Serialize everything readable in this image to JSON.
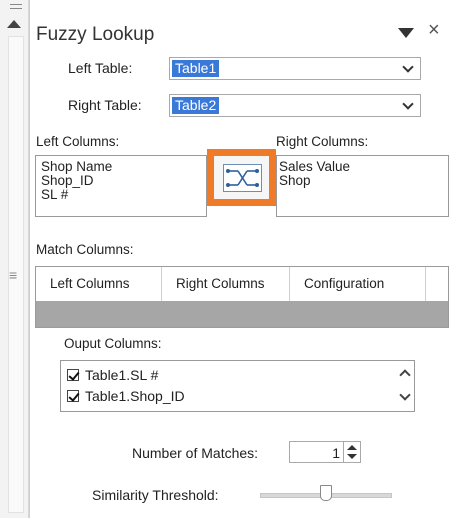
{
  "pane": {
    "title": "Fuzzy Lookup",
    "close_glyph": "×"
  },
  "left_table": {
    "label": "Left Table:",
    "value": "Table1"
  },
  "right_table": {
    "label": "Right Table:",
    "value": "Table2"
  },
  "left_columns": {
    "label": "Left Columns:",
    "items": [
      "Shop Name",
      "Shop_ID",
      "SL #"
    ]
  },
  "right_columns": {
    "label": "Right Columns:",
    "items": [
      "Sales Value",
      "Shop"
    ]
  },
  "match_columns": {
    "label": "Match Columns:",
    "headers": [
      "Left Columns",
      "Right Columns",
      "Configuration"
    ]
  },
  "output_columns": {
    "label": "Ouput Columns:",
    "items": [
      {
        "label": "Table1.SL #",
        "checked": true
      },
      {
        "label": "Table1.Shop_ID",
        "checked": true
      }
    ]
  },
  "number_of_matches": {
    "label": "Number of Matches:",
    "value": "1"
  },
  "similarity_threshold": {
    "label": "Similarity Threshold:",
    "level_fraction": 0.5
  },
  "icons": {
    "map_button": "column-mapping-icon",
    "title_dropdown": "triangle-down-icon",
    "close": "close-icon"
  },
  "colors": {
    "highlight": "#ef7b28",
    "selection": "#3a79d8"
  }
}
